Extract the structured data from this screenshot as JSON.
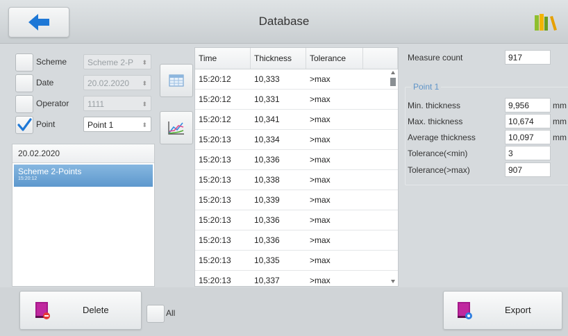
{
  "header": {
    "title": "Database"
  },
  "filters": {
    "scheme": {
      "label": "Scheme",
      "value": "Scheme 2-P",
      "checked": false
    },
    "date": {
      "label": "Date",
      "value": "20.02.2020",
      "checked": false
    },
    "operator": {
      "label": "Operator",
      "value": "1111",
      "checked": false
    },
    "point": {
      "label": "Point",
      "value": "Point 1",
      "checked": true
    }
  },
  "list": {
    "header": "20.02.2020",
    "items": [
      {
        "title": "Scheme 2-Points",
        "time": "15:20:12"
      }
    ]
  },
  "table": {
    "columns": [
      "Time",
      "Thickness",
      "Tolerance",
      ""
    ],
    "rows": [
      [
        "15:20:12",
        "10,333",
        ">max"
      ],
      [
        "15:20:12",
        "10,331",
        ">max"
      ],
      [
        "15:20:12",
        "10,341",
        ">max"
      ],
      [
        "15:20:13",
        "10,334",
        ">max"
      ],
      [
        "15:20:13",
        "10,336",
        ">max"
      ],
      [
        "15:20:13",
        "10,338",
        ">max"
      ],
      [
        "15:20:13",
        "10,339",
        ">max"
      ],
      [
        "15:20:13",
        "10,336",
        ">max"
      ],
      [
        "15:20:13",
        "10,336",
        ">max"
      ],
      [
        "15:20:13",
        "10,335",
        ">max"
      ],
      [
        "15:20:13",
        "10,337",
        ">max"
      ]
    ]
  },
  "stats": {
    "measure_count_label": "Measure count",
    "measure_count": "917",
    "group_title": "Point 1",
    "min_label": "Min. thickness",
    "min_value": "9,956",
    "max_label": "Max. thickness",
    "max_value": "10,674",
    "avg_label": "Average thickness",
    "avg_value": "10,097",
    "tol_min_label": "Tolerance(<min)",
    "tol_min_value": "3",
    "tol_max_label": "Tolerance(>max)",
    "tol_max_value": "907",
    "unit": "mm"
  },
  "bottom": {
    "delete_label": "Delete",
    "all_label": "All",
    "export_label": "Export"
  },
  "colors": {
    "accent": "#1e78d6",
    "selection": "#6fa6d6"
  }
}
